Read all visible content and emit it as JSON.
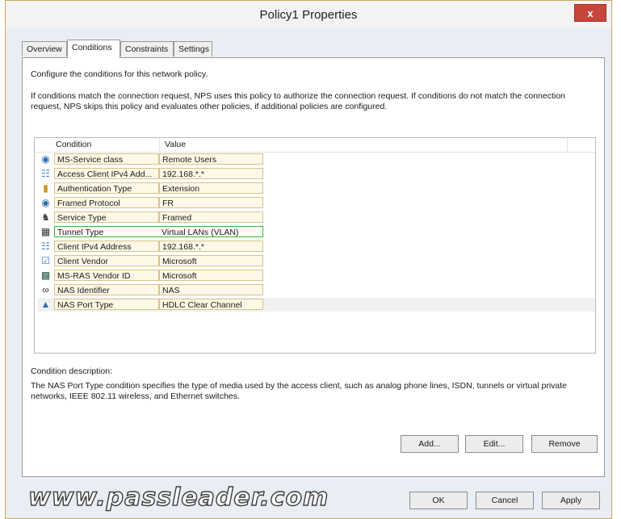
{
  "window": {
    "title": "Policy1 Properties",
    "close_label": "x"
  },
  "tabs": [
    {
      "label": "Overview"
    },
    {
      "label": "Conditions",
      "active": true
    },
    {
      "label": "Constraints"
    },
    {
      "label": "Settings"
    }
  ],
  "panel": {
    "intro": "Configure the conditions for this network policy.",
    "description": "If conditions match the connection request, NPS uses this policy to authorize the connection request. If conditions do not match the connection request, NPS skips this policy and evaluates other policies, if additional policies are configured."
  },
  "list": {
    "columns": [
      "Condition",
      "Value"
    ],
    "rows": [
      {
        "icon": "network-policy-icon",
        "condition": "MS-Service class",
        "value": "Remote Users"
      },
      {
        "icon": "client-ipv4-icon",
        "condition": "Access Client IPv4 Add...",
        "value": "192.168.*.*"
      },
      {
        "icon": "lock-icon",
        "condition": "Authentication Type",
        "value": "Extension"
      },
      {
        "icon": "network-policy-icon",
        "condition": "Framed Protocol",
        "value": "FR"
      },
      {
        "icon": "service-type-icon",
        "condition": "Service Type",
        "value": "Framed"
      },
      {
        "icon": "tunnel-type-icon",
        "condition": "Tunnel Type",
        "value": "Virtual LANs (VLAN)",
        "selected": true
      },
      {
        "icon": "client-ipv4-icon",
        "condition": "Client IPv4 Address",
        "value": "192.168.*.*"
      },
      {
        "icon": "checkbox-icon",
        "condition": "Client Vendor",
        "value": "Microsoft"
      },
      {
        "icon": "server-icon",
        "condition": "MS-RAS Vendor ID",
        "value": "Microsoft"
      },
      {
        "icon": "nas-identifier-icon",
        "condition": "NAS Identifier",
        "value": "NAS"
      },
      {
        "icon": "nas-port-icon",
        "condition": "NAS Port Type",
        "value": "HDLC Clear Channel"
      }
    ]
  },
  "condition_description": {
    "label": "Condition description:",
    "text": "The NAS Port Type condition specifies the type of media used by the access client, such as analog phone lines, ISDN, tunnels or virtual private networks, IEEE 802.11 wireless, and Ethernet switches."
  },
  "actions": {
    "add": "Add...",
    "edit": "Edit...",
    "remove": "Remove"
  },
  "footer": {
    "ok": "OK",
    "cancel": "Cancel",
    "apply": "Apply"
  },
  "watermark": "www.passleader.com",
  "colors": {
    "selected_border": "#36b53a",
    "row_border": "#d8c28a",
    "close_button": "#c7463c"
  }
}
